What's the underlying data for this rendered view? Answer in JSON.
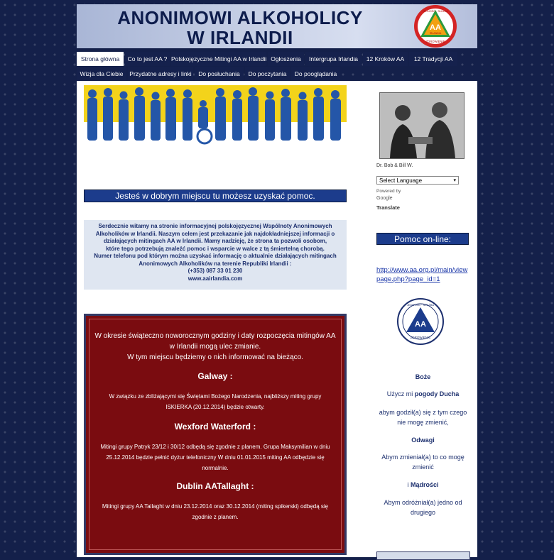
{
  "header": {
    "title_line1": "ANONIMOWI ALKOHOLICY",
    "title_line2": "W IRLANDII",
    "logo_top": "JEDNOŚĆ · SŁUŻBA",
    "logo_center": "AA",
    "logo_sub": "IRLANDIA",
    "logo_bottom": "ZDROWIENIE"
  },
  "nav": {
    "row1": [
      "Strona główna",
      "Co to jest AA ?",
      "Polskojęzyczne Mitingi AA w Irlandii",
      "Ogłoszenia",
      "Intergrupa Irlandia",
      "12 Kroków AA",
      "12 Tradycji AA"
    ],
    "row2": [
      "Wizja dla Ciebie",
      "Przydatne adresy i linki",
      "Do posłuchania",
      "Do poczytania",
      "Do pooglądania"
    ],
    "active": "Strona główna"
  },
  "main": {
    "welcome_bar": "Jesteś w dobrym miejscu tu możesz uzyskać pomoc.",
    "intro_lines": [
      "Serdecznie witamy na stronie informacyjnej polskojęzycznej Wspólnoty Anonimowych",
      "Alkoholików w Irlandii. Naszym celem jest przekazanie jak najdokładniejszej informacji o",
      "działających mitingach AA w Irlandii. Mamy nadzieję, że strona ta pozwoli osobom,",
      "które tego potrzebują znaleźć pomoc i wsparcie w walce z tą śmiertelną chorobą.",
      "Numer telefonu pod którym można uzyskać informację o aktualnie działających mitingach",
      "Anonimowych Alkoholików na terenie Republiki Irlandii :",
      "(+353) 087 33 01 230",
      "www.aairlandia.com"
    ],
    "notice": {
      "intro_lines": [
        "W okresie świąteczno noworocznym godziny i daty rozpoczęcia mitingów AA",
        "w Irlandii mogą ulec zmianie.",
        "W tym miejscu będziemy o nich informować na bieżąco."
      ],
      "galway_heading": "Galway :",
      "galway_lines": [
        "W związku ze zbliżającymi się Świętami Bożego Narodzenia, najbliższy miting grupy",
        "ISKIERKA (20.12.2014) będzie otwarty."
      ],
      "wexford_heading": "Wexford Waterford :",
      "wexford_lines": [
        "Mitingi grupy Patryk 23/12 i 30/12 odbędą się zgodnie z planem. Grupa Maksymilian w dniu",
        "25.12.2014 będzie pełnić dyżur telefoniczny W dniu 01.01.2015 miting AA odbędzie się",
        "normalnie."
      ],
      "dublin_heading": "Dublin AATallaght :",
      "dublin_lines": [
        "Mitingi grupy AA Tallaght w dniu 23.12.2014 oraz 30.12.2014 (miting spikerski) odbędą się",
        "zgodnie z planem."
      ]
    }
  },
  "sidebar": {
    "photo_caption": "Dr. Bob & Bill W.",
    "language_select": "Select Language",
    "powered_by": "Powered by",
    "google": "Google",
    "translate": "Translate",
    "help_bar": "Pomoc on-line:",
    "help_link": "http://www.aa.org.pl/main/viewpage.php?page_id=1",
    "logo2_top": "JEDNOŚĆ · SŁUŻBA",
    "logo2_center": "AA",
    "logo2_bottom": "ZDROWIENIE",
    "prayer": {
      "l1": "Boże",
      "l2a": "Użycz mi ",
      "l2b": "pogody Ducha",
      "l3": "abym godził(a) się z tym czego",
      "l4": "nie mogę zmienić,",
      "l5": "Odwagi",
      "l6": "Abym zmieniał(a) to co mogę",
      "l7": "zmienić",
      "l8a": "i ",
      "l8b": "Mądrości",
      "l9": "Abym odróżniał(a) jedno od",
      "l10": "drugiego"
    }
  },
  "colors": {
    "navy": "#15214d",
    "accent_blue": "#1c3c8c",
    "notice_red": "#7a0c10"
  }
}
